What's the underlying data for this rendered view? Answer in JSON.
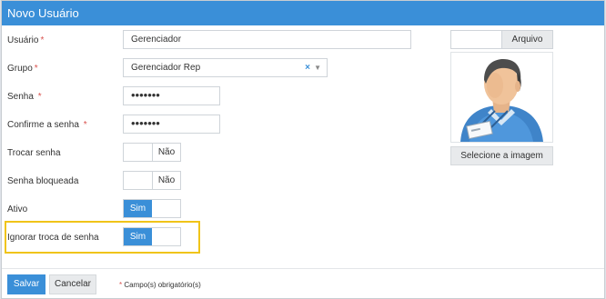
{
  "window": {
    "title": "Novo Usuário"
  },
  "form": {
    "username": {
      "label": "Usuário",
      "required": "*",
      "value": "Gerenciador"
    },
    "group": {
      "label": "Grupo",
      "required": "*",
      "value": "Gerenciador Rep",
      "clear_icon": "×",
      "caret_icon": "▼"
    },
    "password": {
      "label": "Senha",
      "required": "*",
      "value": "•••••••"
    },
    "confirm_password": {
      "label": "Confirme a senha",
      "required": "*",
      "value": "•••••••"
    },
    "change_password": {
      "label": "Trocar senha",
      "state": "Não"
    },
    "password_locked": {
      "label": "Senha bloqueada",
      "state": "Não"
    },
    "active": {
      "label": "Ativo",
      "state": "Sim"
    },
    "ignore_password_change": {
      "label": "Ignorar troca de senha",
      "state": "Sim"
    }
  },
  "photo": {
    "file_button": "Arquivo",
    "select_image_button": "Selecione a imagem"
  },
  "footer": {
    "save": "Salvar",
    "cancel": "Cancelar",
    "required_note_mark": "*",
    "required_note": "Campo(s) obrigatório(s)"
  },
  "colors": {
    "accent": "#3a8fd8",
    "required": "#d9534f",
    "highlight": "#f0c419"
  }
}
